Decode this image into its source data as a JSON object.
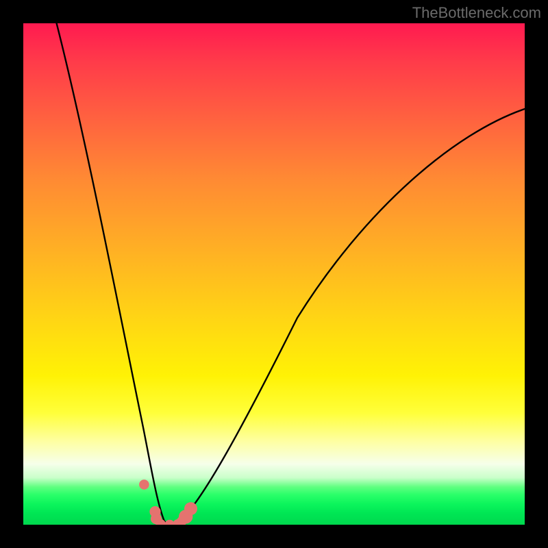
{
  "watermark": "TheBottleneck.com",
  "colors": {
    "frame": "#000000",
    "curve_stroke": "#000000",
    "marker_fill": "#e5736f",
    "gradient_top": "#ff1a50",
    "gradient_bottom": "#00d84e"
  },
  "chart_data": {
    "type": "line",
    "title": "",
    "xlabel": "",
    "ylabel": "",
    "xlim": [
      0,
      100
    ],
    "ylim": [
      0,
      100
    ],
    "grid": false,
    "legend": false,
    "note": "V-shaped curve over rainbow gradient; y reaches 0 (bottom/green) near x≈29 and rises toward 100 (top/red) at the extremes. Values are approximate readings from pixel positions.",
    "series": [
      {
        "name": "curve",
        "x": [
          6,
          10,
          14,
          18,
          22,
          24,
          26,
          28,
          29,
          30,
          32,
          34,
          38,
          44,
          50,
          58,
          66,
          74,
          82,
          90,
          100
        ],
        "values": [
          100,
          80,
          58,
          36,
          14,
          7,
          3,
          0,
          0,
          0,
          1,
          4,
          12,
          24,
          35,
          48,
          58,
          66,
          73,
          78,
          83
        ]
      }
    ],
    "markers": [
      {
        "x": 24.1,
        "y": 8.0,
        "r": 1.0
      },
      {
        "x": 26.3,
        "y": 2.6,
        "r": 1.1
      },
      {
        "x": 26.5,
        "y": 1.2,
        "r": 1.1
      },
      {
        "x": 27.4,
        "y": 0.1,
        "r": 1.0
      },
      {
        "x": 29.2,
        "y": 0.0,
        "r": 1.0
      },
      {
        "x": 30.8,
        "y": 0.1,
        "r": 1.0
      },
      {
        "x": 31.6,
        "y": 0.7,
        "r": 1.0
      },
      {
        "x": 32.4,
        "y": 1.6,
        "r": 1.4
      },
      {
        "x": 33.4,
        "y": 3.2,
        "r": 1.3
      }
    ]
  }
}
